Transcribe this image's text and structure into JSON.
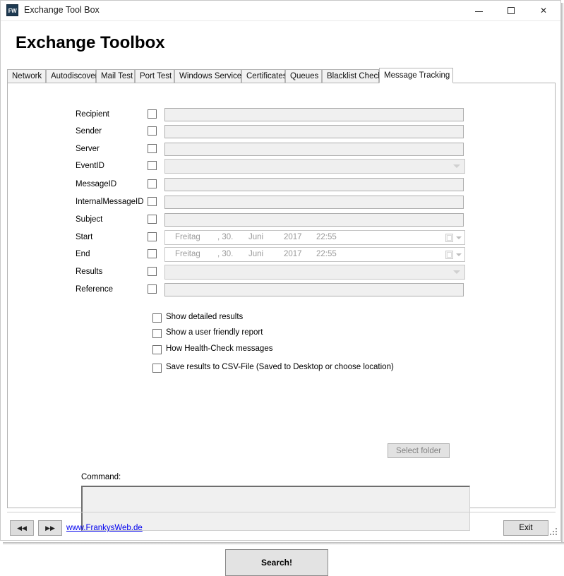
{
  "window": {
    "icon_text": "FW",
    "icon_name": "fw-app-icon",
    "title": "Exchange Tool Box",
    "minimize_label": "Minimize",
    "maximize_label": "Maximize",
    "close_label": "Close"
  },
  "header": {
    "page_title": "Exchange Toolbox"
  },
  "tabs": [
    {
      "label": "Network",
      "active": false
    },
    {
      "label": "Autodiscover",
      "active": false
    },
    {
      "label": "Mail Test",
      "active": false
    },
    {
      "label": "Port Test",
      "active": false
    },
    {
      "label": "Windows Services",
      "active": false
    },
    {
      "label": "Certificates",
      "active": false
    },
    {
      "label": "Queues",
      "active": false
    },
    {
      "label": "Blacklist Check",
      "active": false
    },
    {
      "label": "Message Tracking",
      "active": true
    }
  ],
  "form": {
    "fields": [
      {
        "label": "Recipient",
        "type": "text",
        "value": "",
        "checked": false
      },
      {
        "label": "Sender",
        "type": "text",
        "value": "",
        "checked": false
      },
      {
        "label": "Server",
        "type": "text",
        "value": "",
        "checked": false
      },
      {
        "label": "EventID",
        "type": "combo",
        "value": "",
        "checked": false
      },
      {
        "label": "MessageID",
        "type": "text",
        "value": "",
        "checked": false
      },
      {
        "label": "InternalMessageID",
        "type": "text",
        "value": "",
        "checked": false
      },
      {
        "label": "Subject",
        "type": "text",
        "value": "",
        "checked": false
      },
      {
        "label": "Start",
        "type": "date",
        "value": "",
        "checked": false
      },
      {
        "label": "End",
        "type": "date",
        "value": "",
        "checked": false
      },
      {
        "label": "Results",
        "type": "combo",
        "value": "",
        "checked": false
      },
      {
        "label": "Reference",
        "type": "text",
        "value": "",
        "checked": false
      }
    ],
    "date_value": {
      "weekday": "Freitag",
      "day": ", 30.",
      "month": "Juni",
      "year": "2017",
      "time": "22:55"
    }
  },
  "options": [
    {
      "label": "Show detailed results",
      "checked": false
    },
    {
      "label": "Show a user friendly report",
      "checked": false
    },
    {
      "label": "How Health-Check messages",
      "checked": false
    },
    {
      "label": "Save results to CSV-File (Saved to Desktop or choose location)",
      "checked": false
    }
  ],
  "buttons": {
    "select_folder": "Select folder",
    "search": "Search!",
    "exit": "Exit",
    "nav_prev": "◀◀",
    "nav_next": "▶▶"
  },
  "command": {
    "label": "Command:",
    "value": ""
  },
  "footer": {
    "link": "www.FrankysWeb.de"
  },
  "colors": {
    "accent": "#1e3a52",
    "link": "#0000ee",
    "button_face": "#e1e1e1",
    "field_disabled": "#f0f0f0"
  }
}
